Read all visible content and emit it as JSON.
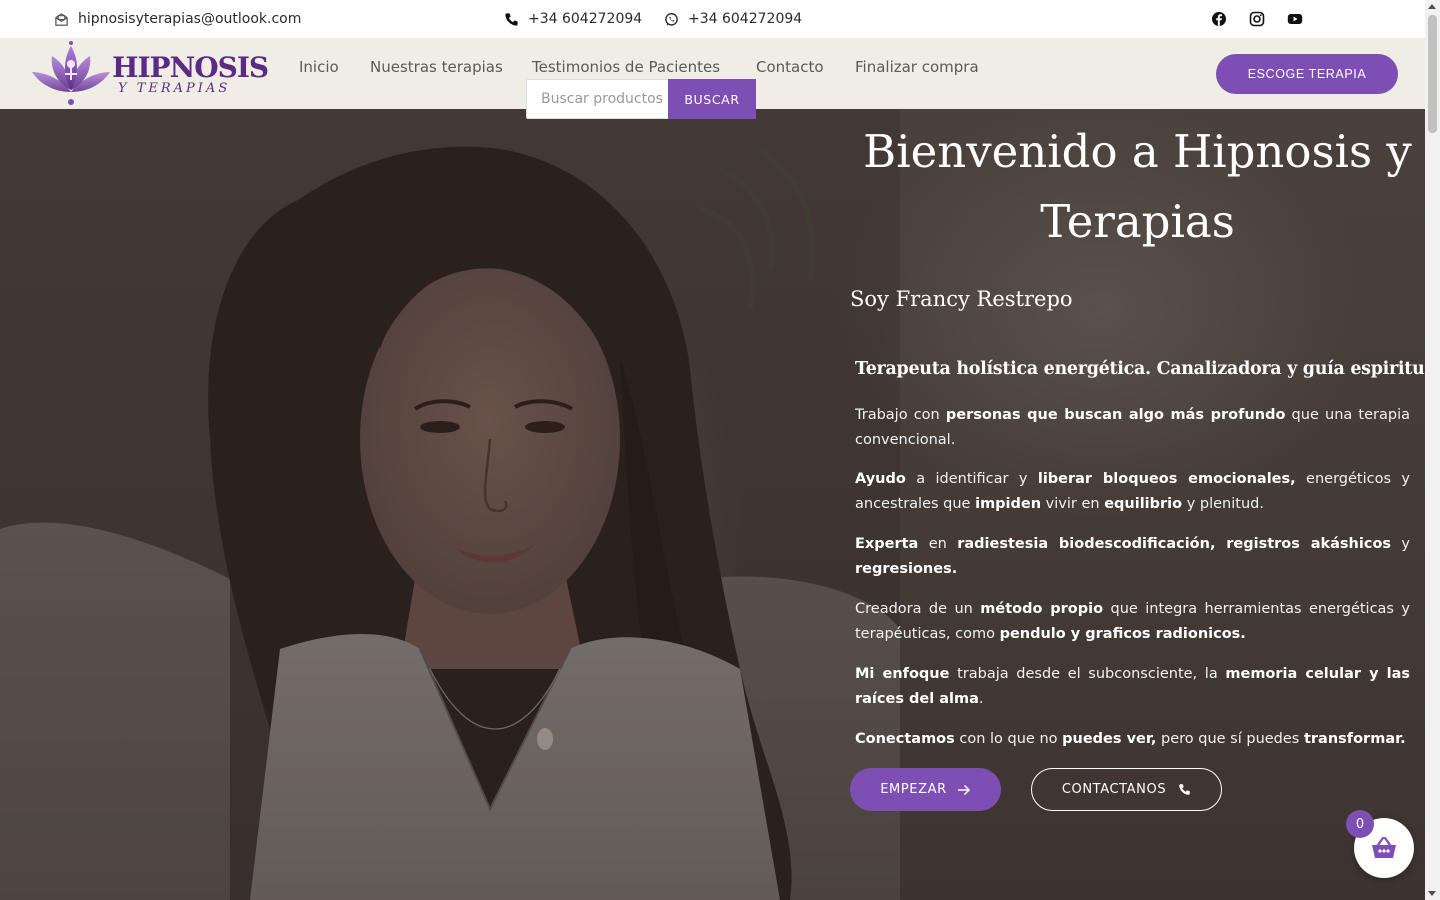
{
  "topbar": {
    "email": "hipnosisyterapias@outlook.com",
    "phone": "+34 604272094",
    "whatsapp": "+34 604272094",
    "social_icons": [
      "facebook-icon",
      "instagram-icon",
      "youtube-icon"
    ]
  },
  "logo": {
    "main": "HIPNOSIS",
    "sub": "Y TERAPIAS"
  },
  "nav": {
    "items": [
      {
        "label": "Inicio"
      },
      {
        "label": "Nuestras terapias"
      },
      {
        "label": "Testimonios de Pacientes"
      },
      {
        "label": "Contacto"
      },
      {
        "label": "Finalizar compra"
      }
    ],
    "cta": "ESCOGE TERAPIA"
  },
  "search": {
    "placeholder": "Buscar productos",
    "button": "BUSCAR"
  },
  "hero": {
    "title": "Bienvenido a Hipnosis y Terapias",
    "subtitle": "Soy Francy Restrepo",
    "lead": "Terapeuta holística energética. Canalizadora y guía espiritual.",
    "p1": {
      "a": "Trabajo con ",
      "b": "personas que buscan algo más profundo",
      "c": " que una terapia convencional."
    },
    "p2": {
      "a": "Ayudo",
      "b": " a identificar y ",
      "c": "liberar bloqueos emocionales,",
      "d": " energéticos y ancestrales que ",
      "e": "impiden",
      "f": " vivir en ",
      "g": "equilibrio",
      "h": " y plenitud."
    },
    "p3": {
      "a": "Experta",
      "b": " en ",
      "c": "radiestesia biodescodificación, registros akáshicos",
      "d": " y ",
      "e": "regresiones."
    },
    "p4": {
      "a": "Creadora de un ",
      "b": "método propio",
      "c": " que integra herramientas energéticas y terapéuticas, como ",
      "d": "pendulo y graficos radionicos."
    },
    "p5": {
      "a": "Mi enfoque",
      "b": " trabaja desde el subconsciente, la ",
      "c": "memoria celular y las raíces del alma",
      "d": "."
    },
    "p6": {
      "a": "Conectamos",
      "b": " con lo que no ",
      "c": "puedes ver,",
      "d": " pero que sí puedes ",
      "e": "transformar."
    },
    "btn_start": "EMPEZAR",
    "btn_contact": "CONTACTANOS"
  },
  "cart": {
    "count": "0"
  },
  "colors": {
    "accent": "#7d4eb4",
    "header_bg": "#efede4",
    "logo": "#5b2a86"
  }
}
